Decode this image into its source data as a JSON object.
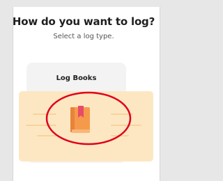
{
  "dialog": {
    "title": "How do you want to log?",
    "subtitle": "Select a log type."
  },
  "option": {
    "label": "Log Books",
    "icon": "book-icon"
  },
  "colors": {
    "accent_bg": "#fde7c3",
    "book_body": "#f59a4b",
    "bookmark": "#e84a6a",
    "highlight": "#e0001b"
  }
}
